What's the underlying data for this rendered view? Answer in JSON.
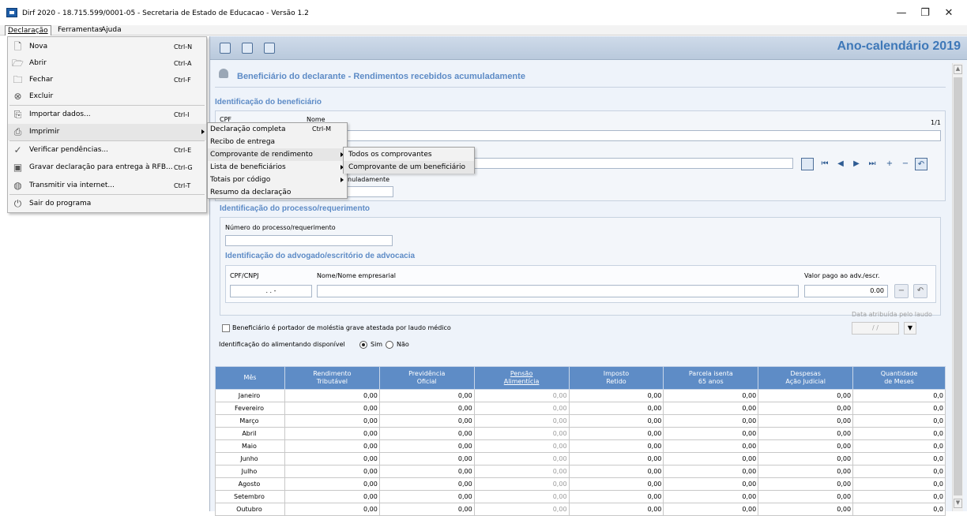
{
  "window": {
    "title": "Dirf 2020 - 18.715.599/0001-05 - Secretaria de Estado de Educacao - Versão 1.2",
    "minimize": "—",
    "maximize": "❐",
    "close": "✕"
  },
  "menubar": {
    "items": [
      "Declaração",
      "Ferramentas",
      "Ajuda"
    ]
  },
  "dropdown": [
    {
      "label": "Nova",
      "shortcut": "Ctrl-N",
      "icon": "new-file-icon",
      "glyph": "🗋"
    },
    {
      "label": "Abrir",
      "shortcut": "Ctrl-A",
      "icon": "open-folder-icon",
      "glyph": "🗁"
    },
    {
      "label": "Fechar",
      "shortcut": "Ctrl-F",
      "icon": "folder-icon",
      "glyph": "🗀"
    },
    {
      "label": "Excluir",
      "shortcut": "",
      "icon": "delete-icon",
      "glyph": "⊗"
    },
    {
      "label": "Importar dados...",
      "shortcut": "Ctrl-I",
      "icon": "import-icon",
      "glyph": "⎘"
    },
    {
      "label": "Imprimir",
      "shortcut": "",
      "icon": "printer-icon",
      "glyph": "⎙"
    },
    {
      "label": "Verificar pendências...",
      "shortcut": "Ctrl-E",
      "icon": "check-icon",
      "glyph": "✓"
    },
    {
      "label": "Gravar declaração para entrega à RFB...",
      "shortcut": "Ctrl-G",
      "icon": "save-icon",
      "glyph": "▣"
    },
    {
      "label": "Transmitir via internet...",
      "shortcut": "Ctrl-T",
      "icon": "transmit-icon",
      "glyph": "◍"
    },
    {
      "label": "Sair do programa",
      "shortcut": "",
      "icon": "power-icon",
      "glyph": "⏻"
    }
  ],
  "submenu1": [
    {
      "label": "Declaração completa",
      "shortcut": "Ctrl-M",
      "has_sub": false
    },
    {
      "label": "Recibo de entrega",
      "shortcut": "",
      "has_sub": false
    },
    {
      "label": "Comprovante de rendimento",
      "shortcut": "",
      "has_sub": true
    },
    {
      "label": "Lista de beneficiários",
      "shortcut": "",
      "has_sub": true
    },
    {
      "label": "Totais por código",
      "shortcut": "",
      "has_sub": true
    },
    {
      "label": "Resumo da declaração",
      "shortcut": "",
      "has_sub": false
    }
  ],
  "submenu2": [
    "Todos os comprovantes",
    "Comprovante de um beneficiário"
  ],
  "toolbar": {
    "ano": "Ano-calendário 2019"
  },
  "page": {
    "title": "Beneficiário do declarante - Rendimentos recebidos acumuladamente",
    "sec_benef": "Identificação do beneficiário",
    "cpf_label": "CPF",
    "nome_label": "Nome",
    "counter": "1/1",
    "acumulado_fragment": "nuladamente",
    "sec_proc": "Identificação do processo/requerimento",
    "proc_label": "Número do processo/requerimento",
    "sec_adv": "Identificação do advogado/escritório de advocacia",
    "cpfcnpj_label": "CPF/CNPJ",
    "nomeemp_label": "Nome/Nome empresarial",
    "valor_label": "Valor pago ao adv./escr.",
    "cpfcnpj_value": ". . -",
    "valor_value": "0.00",
    "molestia_label": "Beneficiário é portador de moléstia grave atestada por laudo médico",
    "data_laudo_label": "Data atribuída pelo laudo",
    "data_laudo_value": "/ /",
    "alimentando_label": "Identificação do alimentando disponível",
    "sim": "Sim",
    "nao": "Não"
  },
  "grid": {
    "headers": [
      "Mês",
      "Rendimento\nTributável",
      "Previdência\nOficial",
      "Pensão\nAlimentícia",
      "Imposto\nRetido",
      "Parcela isenta\n65 anos",
      "Despesas\nAção Judicial",
      "Quantidade\nde Meses"
    ],
    "rows": [
      [
        "Janeiro",
        "0,00",
        "0,00",
        "0,00",
        "0,00",
        "0,00",
        "0,00",
        "0,0"
      ],
      [
        "Fevereiro",
        "0,00",
        "0,00",
        "0,00",
        "0,00",
        "0,00",
        "0,00",
        "0,0"
      ],
      [
        "Março",
        "0,00",
        "0,00",
        "0,00",
        "0,00",
        "0,00",
        "0,00",
        "0,0"
      ],
      [
        "Abril",
        "0,00",
        "0,00",
        "0,00",
        "0,00",
        "0,00",
        "0,00",
        "0,0"
      ],
      [
        "Maio",
        "0,00",
        "0,00",
        "0,00",
        "0,00",
        "0,00",
        "0,00",
        "0,0"
      ],
      [
        "Junho",
        "0,00",
        "0,00",
        "0,00",
        "0,00",
        "0,00",
        "0,00",
        "0,0"
      ],
      [
        "Julho",
        "0,00",
        "0,00",
        "0,00",
        "0,00",
        "0,00",
        "0,00",
        "0,0"
      ],
      [
        "Agosto",
        "0,00",
        "0,00",
        "0,00",
        "0,00",
        "0,00",
        "0,00",
        "0,0"
      ],
      [
        "Setembro",
        "0,00",
        "0,00",
        "0,00",
        "0,00",
        "0,00",
        "0,00",
        "0,0"
      ],
      [
        "Outubro",
        "0,00",
        "0,00",
        "0,00",
        "0,00",
        "0,00",
        "0,00",
        "0,0"
      ]
    ]
  }
}
